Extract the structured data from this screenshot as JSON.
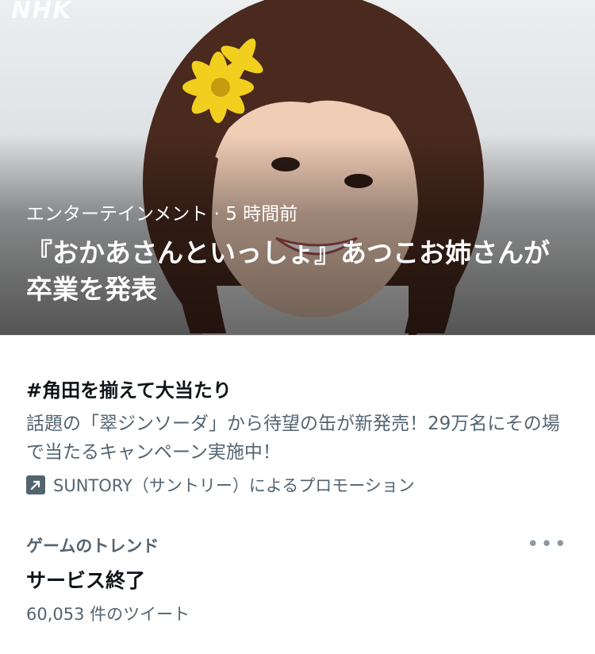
{
  "hero": {
    "logo_text": "NHK",
    "meta": "エンターテインメント · 5 時間前",
    "title": "『おかあさんといっしょ』あつこお姉さんが卒業を発表",
    "image": "photo of smiling woman with yellow flower in hair"
  },
  "promo": {
    "title": "#角田を揃えて大当たり",
    "description": "話題の「翠ジンソーダ」から待望の缶が新発売！29万名にその場で当たるキャンペーン実施中！",
    "sponsor_icon": "promoted-arrow-icon",
    "sponsor": "SUNTORY（サントリー）によるプロモーション"
  },
  "trend": {
    "category": "ゲームのトレンド",
    "more_icon": "more-icon",
    "more_glyph": "•••",
    "name": "サービス終了",
    "count": "60,053 件のツイート"
  },
  "colors": {
    "text_primary": "#0f1419",
    "text_secondary": "#536471",
    "divider": "#e1e3e6"
  }
}
